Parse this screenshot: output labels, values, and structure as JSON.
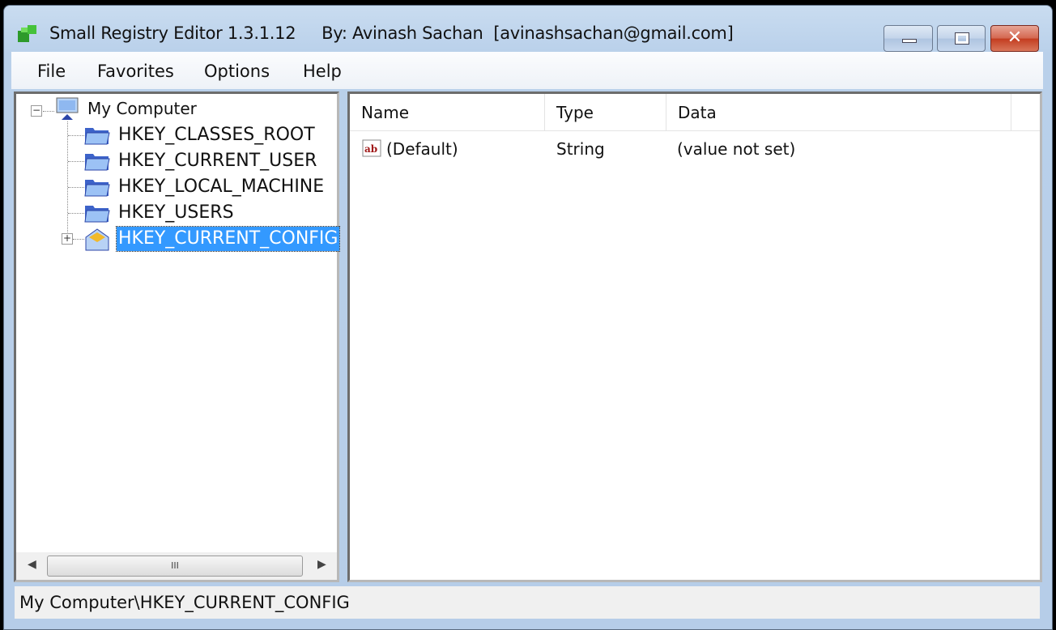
{
  "window": {
    "title": "Small Registry Editor 1.3.1.12     By: Avinash Sachan  [avinashsachan@gmail.com]",
    "minimize_icon": "minimize-icon",
    "maximize_icon": "maximize-icon",
    "close_icon": "close-icon"
  },
  "menu": {
    "items": [
      "File",
      "Favorites",
      "Options",
      "Help"
    ]
  },
  "tree": {
    "root": "My Computer",
    "children": [
      "HKEY_CLASSES_ROOT",
      "HKEY_CURRENT_USER",
      "HKEY_LOCAL_MACHINE",
      "HKEY_USERS",
      "HKEY_CURRENT_CONFIG"
    ],
    "selected": "HKEY_CURRENT_CONFIG",
    "scroll_thumb_grip": "III"
  },
  "list": {
    "columns": [
      "Name",
      "Type",
      "Data"
    ],
    "rows": [
      {
        "name": "(Default)",
        "type": "String",
        "data": "(value not set)"
      }
    ]
  },
  "status": {
    "path": "My Computer\\HKEY_CURRENT_CONFIG"
  }
}
